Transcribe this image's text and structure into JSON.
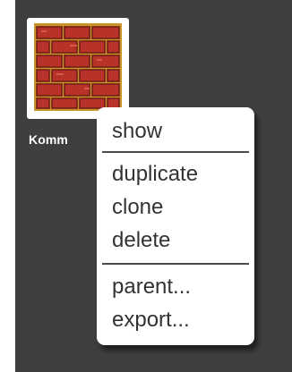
{
  "sprite": {
    "label": "Komm",
    "icon": "brick-wall-costume"
  },
  "context_menu": {
    "items": [
      {
        "label": "show"
      },
      {
        "label": "duplicate"
      },
      {
        "label": "clone"
      },
      {
        "label": "delete"
      },
      {
        "label": "parent..."
      },
      {
        "label": "export..."
      }
    ]
  },
  "colors": {
    "stage_background": "#3f3f3f",
    "menu_background": "#ffffff",
    "menu_text": "#333333",
    "brick": "#c8553a",
    "mortar": "#b8860b"
  }
}
